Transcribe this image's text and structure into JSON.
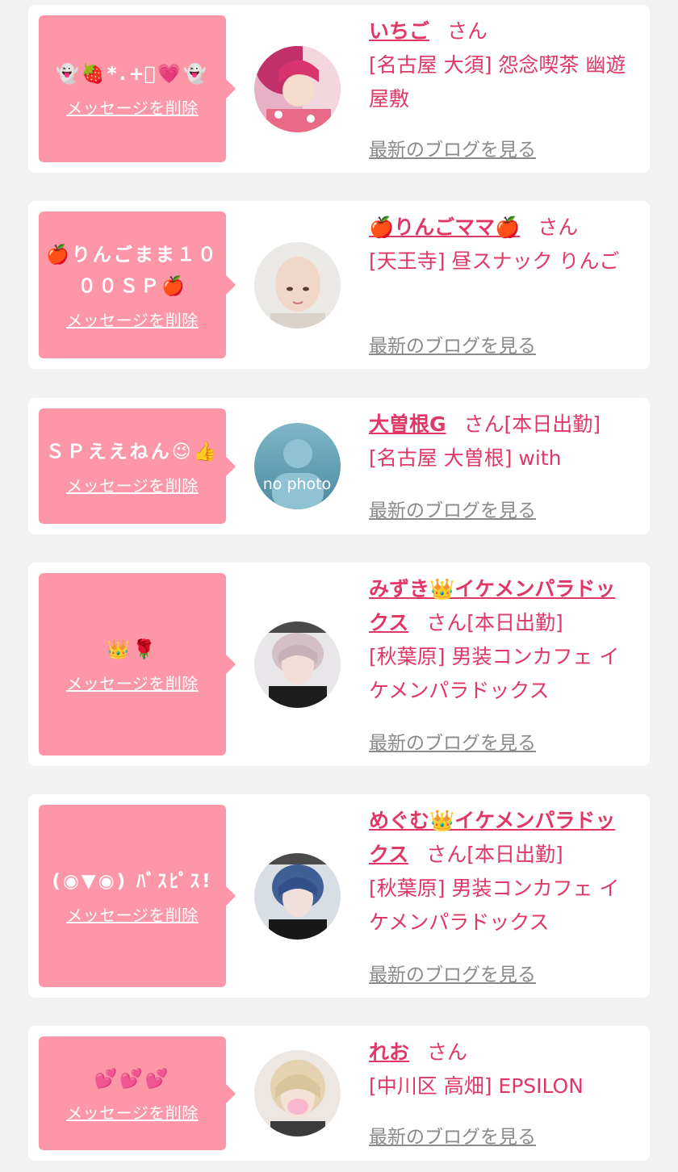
{
  "colors": {
    "page_bg": "#f2f2f2",
    "card_bg": "#ffffff",
    "bubble_bg": "#fd97a8",
    "accent_text": "#e03865",
    "link_gray": "#8a8a8a"
  },
  "entries": [
    {
      "message": "👻🍓*.+ﾟ💗👻",
      "delete_label": "メッセージを削除",
      "name": "いちご",
      "honorific": "さん",
      "badge": "",
      "shop": "[名古屋 大須] 怨念喫茶 幽遊屋敷",
      "blog_link": "最新のブログを見る",
      "avatar_icon": "avatar-photo-pink-hair"
    },
    {
      "message": "🍎りんごまま１０００ＳＰ🍎",
      "delete_label": "メッセージを削除",
      "name": "🍎りんごママ🍎",
      "honorific": "さん",
      "badge": "",
      "shop": "[天王寺] 昼スナック りんご",
      "blog_link": "最新のブログを見る",
      "avatar_icon": "avatar-photo-bald"
    },
    {
      "message": "ＳＰええねん😉👍",
      "delete_label": "メッセージを削除",
      "name": "大曽根G",
      "honorific": "さん",
      "badge": "[本日出勤]",
      "shop": "[名古屋 大曽根] with",
      "blog_link": "最新のブログを見る",
      "avatar_icon": "avatar-no-photo",
      "avatar_text": "no photo"
    },
    {
      "message": "👑🌹",
      "delete_label": "メッセージを削除",
      "name": "みずき👑イケメンパラドックス",
      "honorific": "さん",
      "badge": "[本日出勤]",
      "shop": "[秋葉原] 男装コンカフェ イケメンパラドックス",
      "blog_link": "最新のブログを見る",
      "avatar_icon": "avatar-photo-silver-hair"
    },
    {
      "message": "(◉▼◉) ﾊﾞｽﾋﾟｽ!",
      "delete_label": "メッセージを削除",
      "name": "めぐむ👑イケメンパラドックス",
      "honorific": "さん",
      "badge": "[本日出勤]",
      "shop": "[秋葉原] 男装コンカフェ イケメンパラドックス",
      "blog_link": "最新のブログを見る",
      "avatar_icon": "avatar-photo-blue-hair"
    },
    {
      "message": "💕💕💕",
      "delete_label": "メッセージを削除",
      "name": "れお",
      "honorific": "さん",
      "badge": "",
      "shop": "[中川区 高畑] EPSILON",
      "blog_link": "最新のブログを見る",
      "avatar_icon": "avatar-photo-blonde"
    }
  ]
}
